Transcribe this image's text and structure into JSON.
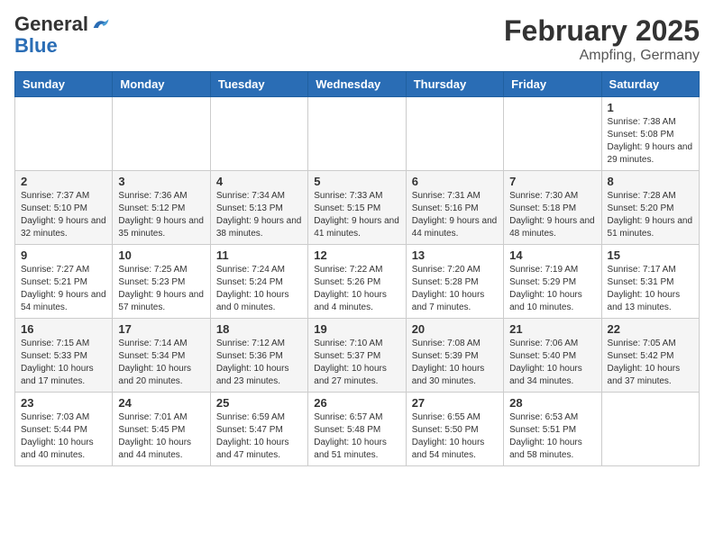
{
  "header": {
    "logo_general": "General",
    "logo_blue": "Blue",
    "month": "February 2025",
    "location": "Ampfing, Germany"
  },
  "weekdays": [
    "Sunday",
    "Monday",
    "Tuesday",
    "Wednesday",
    "Thursday",
    "Friday",
    "Saturday"
  ],
  "weeks": [
    [
      {
        "day": "",
        "info": ""
      },
      {
        "day": "",
        "info": ""
      },
      {
        "day": "",
        "info": ""
      },
      {
        "day": "",
        "info": ""
      },
      {
        "day": "",
        "info": ""
      },
      {
        "day": "",
        "info": ""
      },
      {
        "day": "1",
        "info": "Sunrise: 7:38 AM\nSunset: 5:08 PM\nDaylight: 9 hours and 29 minutes."
      }
    ],
    [
      {
        "day": "2",
        "info": "Sunrise: 7:37 AM\nSunset: 5:10 PM\nDaylight: 9 hours and 32 minutes."
      },
      {
        "day": "3",
        "info": "Sunrise: 7:36 AM\nSunset: 5:12 PM\nDaylight: 9 hours and 35 minutes."
      },
      {
        "day": "4",
        "info": "Sunrise: 7:34 AM\nSunset: 5:13 PM\nDaylight: 9 hours and 38 minutes."
      },
      {
        "day": "5",
        "info": "Sunrise: 7:33 AM\nSunset: 5:15 PM\nDaylight: 9 hours and 41 minutes."
      },
      {
        "day": "6",
        "info": "Sunrise: 7:31 AM\nSunset: 5:16 PM\nDaylight: 9 hours and 44 minutes."
      },
      {
        "day": "7",
        "info": "Sunrise: 7:30 AM\nSunset: 5:18 PM\nDaylight: 9 hours and 48 minutes."
      },
      {
        "day": "8",
        "info": "Sunrise: 7:28 AM\nSunset: 5:20 PM\nDaylight: 9 hours and 51 minutes."
      }
    ],
    [
      {
        "day": "9",
        "info": "Sunrise: 7:27 AM\nSunset: 5:21 PM\nDaylight: 9 hours and 54 minutes."
      },
      {
        "day": "10",
        "info": "Sunrise: 7:25 AM\nSunset: 5:23 PM\nDaylight: 9 hours and 57 minutes."
      },
      {
        "day": "11",
        "info": "Sunrise: 7:24 AM\nSunset: 5:24 PM\nDaylight: 10 hours and 0 minutes."
      },
      {
        "day": "12",
        "info": "Sunrise: 7:22 AM\nSunset: 5:26 PM\nDaylight: 10 hours and 4 minutes."
      },
      {
        "day": "13",
        "info": "Sunrise: 7:20 AM\nSunset: 5:28 PM\nDaylight: 10 hours and 7 minutes."
      },
      {
        "day": "14",
        "info": "Sunrise: 7:19 AM\nSunset: 5:29 PM\nDaylight: 10 hours and 10 minutes."
      },
      {
        "day": "15",
        "info": "Sunrise: 7:17 AM\nSunset: 5:31 PM\nDaylight: 10 hours and 13 minutes."
      }
    ],
    [
      {
        "day": "16",
        "info": "Sunrise: 7:15 AM\nSunset: 5:33 PM\nDaylight: 10 hours and 17 minutes."
      },
      {
        "day": "17",
        "info": "Sunrise: 7:14 AM\nSunset: 5:34 PM\nDaylight: 10 hours and 20 minutes."
      },
      {
        "day": "18",
        "info": "Sunrise: 7:12 AM\nSunset: 5:36 PM\nDaylight: 10 hours and 23 minutes."
      },
      {
        "day": "19",
        "info": "Sunrise: 7:10 AM\nSunset: 5:37 PM\nDaylight: 10 hours and 27 minutes."
      },
      {
        "day": "20",
        "info": "Sunrise: 7:08 AM\nSunset: 5:39 PM\nDaylight: 10 hours and 30 minutes."
      },
      {
        "day": "21",
        "info": "Sunrise: 7:06 AM\nSunset: 5:40 PM\nDaylight: 10 hours and 34 minutes."
      },
      {
        "day": "22",
        "info": "Sunrise: 7:05 AM\nSunset: 5:42 PM\nDaylight: 10 hours and 37 minutes."
      }
    ],
    [
      {
        "day": "23",
        "info": "Sunrise: 7:03 AM\nSunset: 5:44 PM\nDaylight: 10 hours and 40 minutes."
      },
      {
        "day": "24",
        "info": "Sunrise: 7:01 AM\nSunset: 5:45 PM\nDaylight: 10 hours and 44 minutes."
      },
      {
        "day": "25",
        "info": "Sunrise: 6:59 AM\nSunset: 5:47 PM\nDaylight: 10 hours and 47 minutes."
      },
      {
        "day": "26",
        "info": "Sunrise: 6:57 AM\nSunset: 5:48 PM\nDaylight: 10 hours and 51 minutes."
      },
      {
        "day": "27",
        "info": "Sunrise: 6:55 AM\nSunset: 5:50 PM\nDaylight: 10 hours and 54 minutes."
      },
      {
        "day": "28",
        "info": "Sunrise: 6:53 AM\nSunset: 5:51 PM\nDaylight: 10 hours and 58 minutes."
      },
      {
        "day": "",
        "info": ""
      }
    ]
  ]
}
